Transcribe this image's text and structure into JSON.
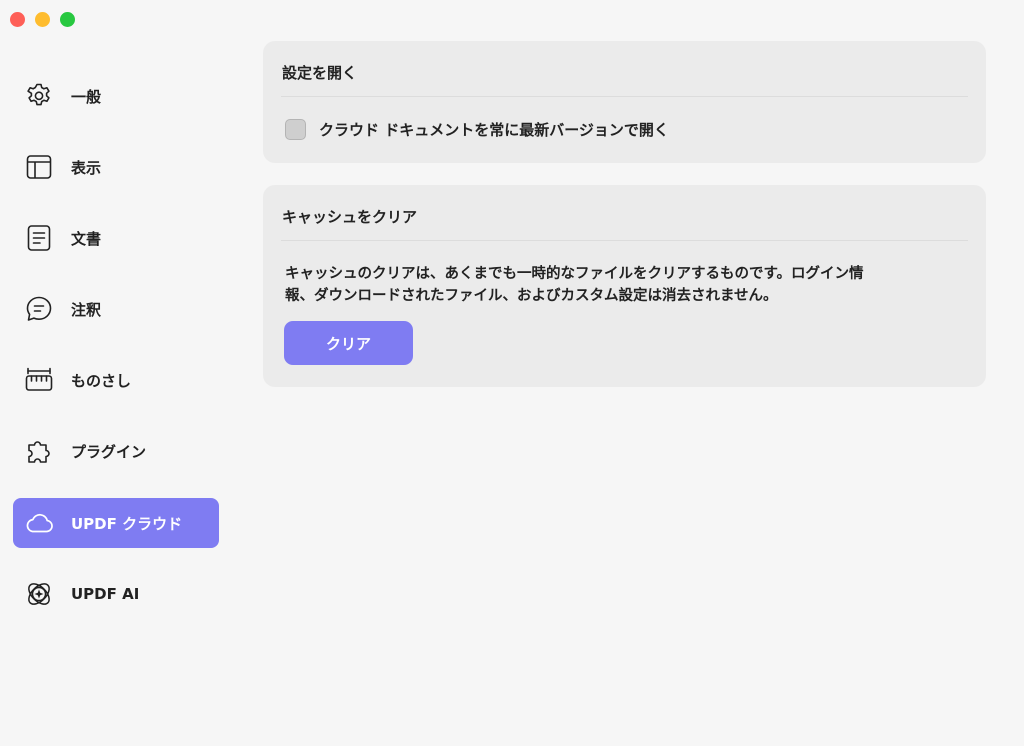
{
  "window": {
    "controls": [
      "close",
      "minimize",
      "maximize"
    ]
  },
  "sidebar": {
    "items": [
      {
        "label": "一般",
        "icon": "gear-icon"
      },
      {
        "label": "表示",
        "icon": "layout-icon"
      },
      {
        "label": "文書",
        "icon": "document-icon"
      },
      {
        "label": "注釈",
        "icon": "comment-icon"
      },
      {
        "label": "ものさし",
        "icon": "ruler-icon"
      },
      {
        "label": "プラグイン",
        "icon": "puzzle-icon"
      },
      {
        "label": "UPDF クラウド",
        "icon": "cloud-icon",
        "active": true
      },
      {
        "label": "UPDF AI",
        "icon": "ai-icon"
      }
    ]
  },
  "open_settings": {
    "title": "設定を開く",
    "checkbox_label": "クラウド ドキュメントを常に最新バージョンで開く",
    "checked": false
  },
  "cache": {
    "title": "キャッシュをクリア",
    "description_line1": "キャッシュのクリアは、あくまでも一時的なファイルをクリアするものです。ログイン情",
    "description_line2": "報、ダウンロードされたファイル、およびカスタム設定は消去されません。",
    "clear_button": "クリア"
  },
  "colors": {
    "accent": "#7f7cf2",
    "card": "#ebebeb",
    "background": "#f6f6f6"
  }
}
